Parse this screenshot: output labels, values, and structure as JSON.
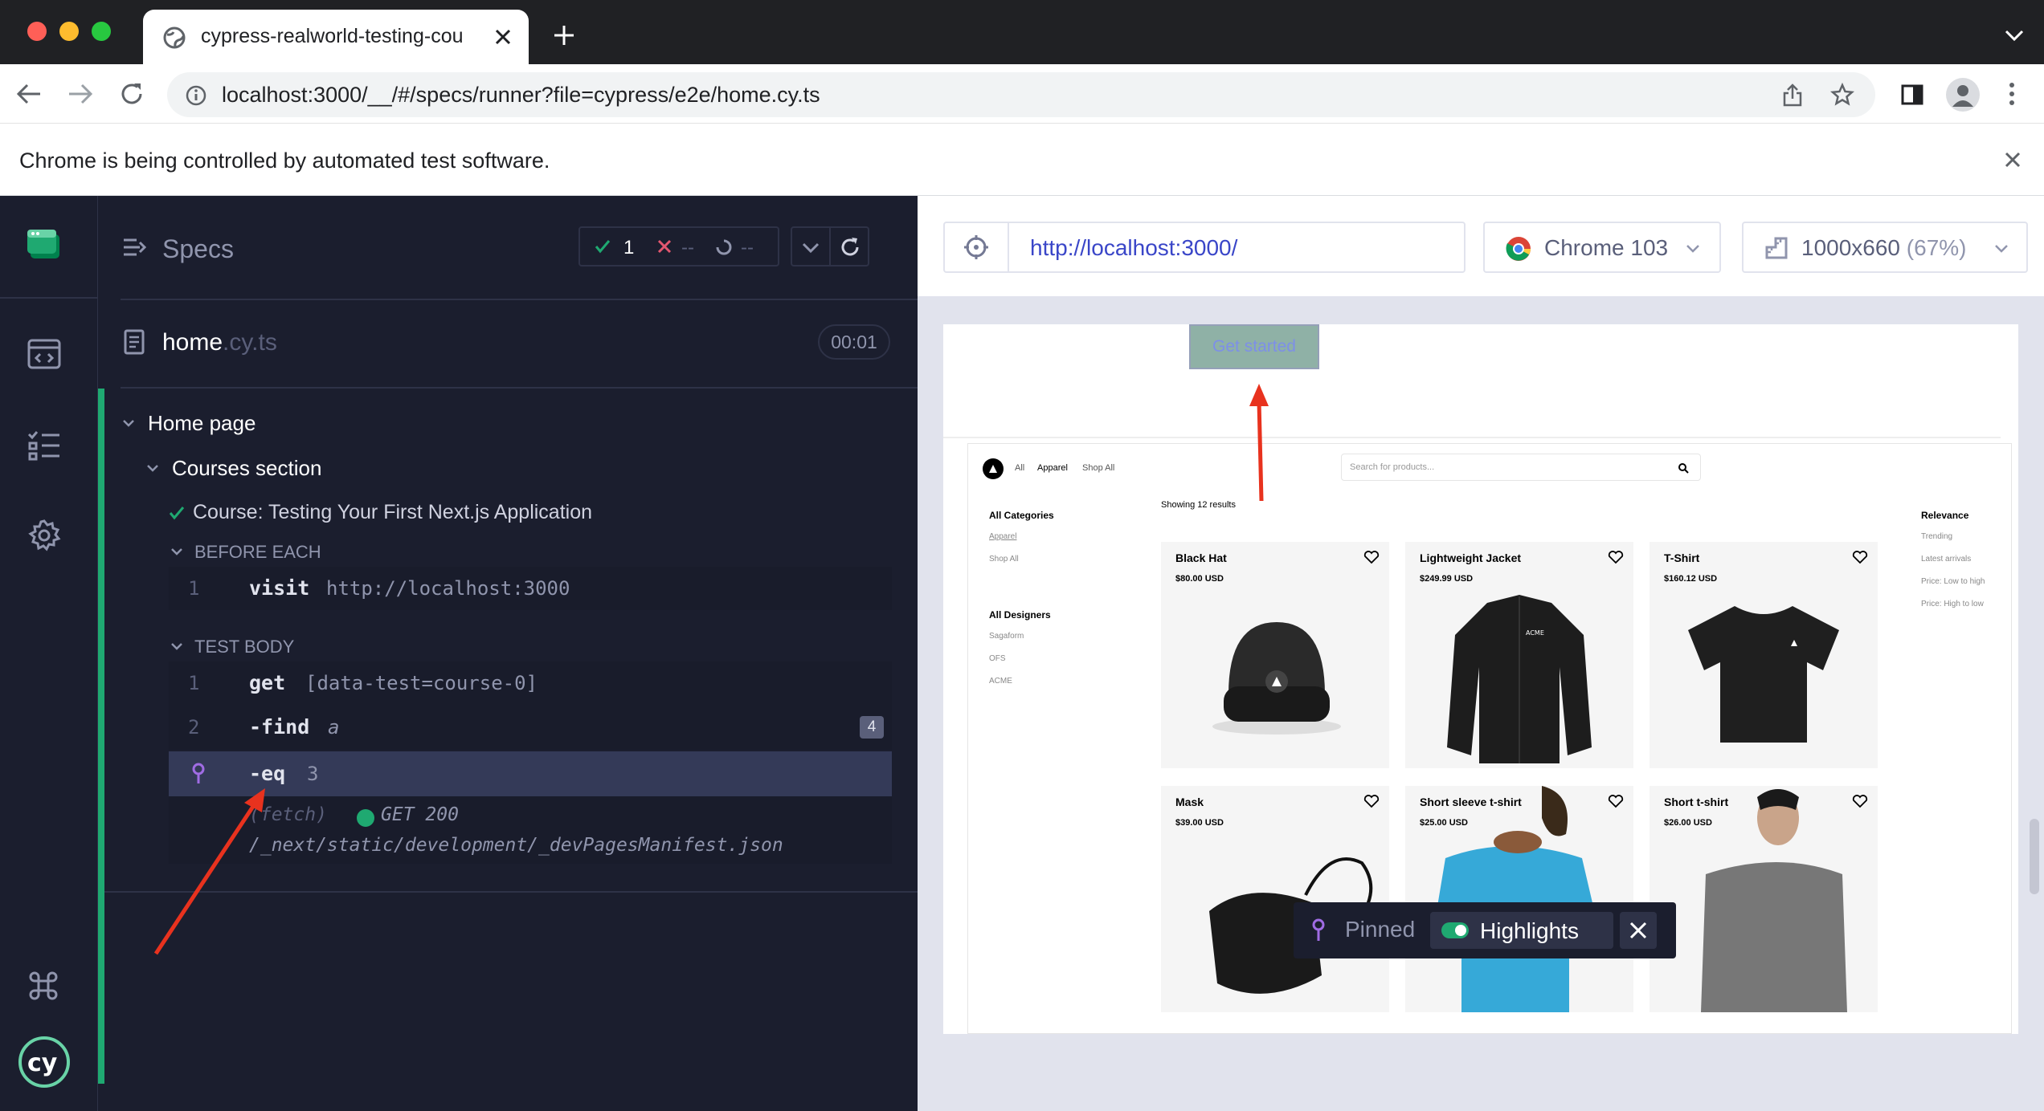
{
  "browser": {
    "tab_title": "cypress-realworld-testing-cou",
    "url": "localhost:3000/__/#/specs/runner?file=cypress/e2e/home.cy.ts",
    "infobar_text": "Chrome is being controlled by automated test software."
  },
  "reporter": {
    "specs_label": "Specs",
    "passed": "1",
    "failed": "--",
    "pending": "--",
    "spec_name": "home",
    "spec_ext": ".cy.ts",
    "duration": "00:01",
    "suite": "Home page",
    "subsuite": "Courses section",
    "test_title": "Course: Testing Your First Next.js Application",
    "before_each_label": "BEFORE EACH",
    "test_body_label": "TEST BODY",
    "before_each": [
      {
        "num": "1",
        "name": "visit",
        "arg": "http://localhost:3000"
      }
    ],
    "body": [
      {
        "num": "1",
        "name": "get",
        "arg": "[data-test=course-0]",
        "badge": ""
      },
      {
        "num": "2",
        "name": "-find",
        "arg": "a",
        "badge": "4"
      },
      {
        "num": "",
        "name": "-eq",
        "arg": "3",
        "badge": ""
      }
    ],
    "fetch": {
      "label": "(fetch)",
      "status": "GET 200",
      "path": "/_next/static/development/_devPagesManifest.json"
    }
  },
  "aut": {
    "url": "http://localhost:3000/",
    "browser": "Chrome 103",
    "viewport": "1000x660",
    "zoom": "(67%)",
    "get_started": "Get started",
    "pinned": "Pinned",
    "highlights": "Highlights"
  },
  "store": {
    "nav": [
      "All",
      "Apparel",
      "Shop All"
    ],
    "search_placeholder": "Search for products...",
    "categories_title": "All Categories",
    "categories": [
      "Apparel",
      "Shop All"
    ],
    "designers_title": "All Designers",
    "designers": [
      "Sagaform",
      "OFS",
      "ACME"
    ],
    "results": "Showing 12 results",
    "sort_title": "Relevance",
    "sort_options": [
      "Trending",
      "Latest arrivals",
      "Price: Low to high",
      "Price: High to low"
    ],
    "products": [
      {
        "name": "Black Hat",
        "price": "$80.00 USD"
      },
      {
        "name": "Lightweight Jacket",
        "price": "$249.99 USD"
      },
      {
        "name": "T-Shirt",
        "price": "$160.12 USD"
      },
      {
        "name": "Mask",
        "price": "$39.00 USD"
      },
      {
        "name": "Short sleeve t-shirt",
        "price": "$25.00 USD"
      },
      {
        "name": "Short t-shirt",
        "price": "$26.00 USD"
      }
    ]
  },
  "colors": {
    "chrome_dark": "#202124",
    "cypress_bg": "#1b1e2e",
    "pass": "#1fa971",
    "fail": "#e45770",
    "indigo": "#6470f3",
    "purple": "#a06ce4",
    "annotation": "#e8321e"
  }
}
